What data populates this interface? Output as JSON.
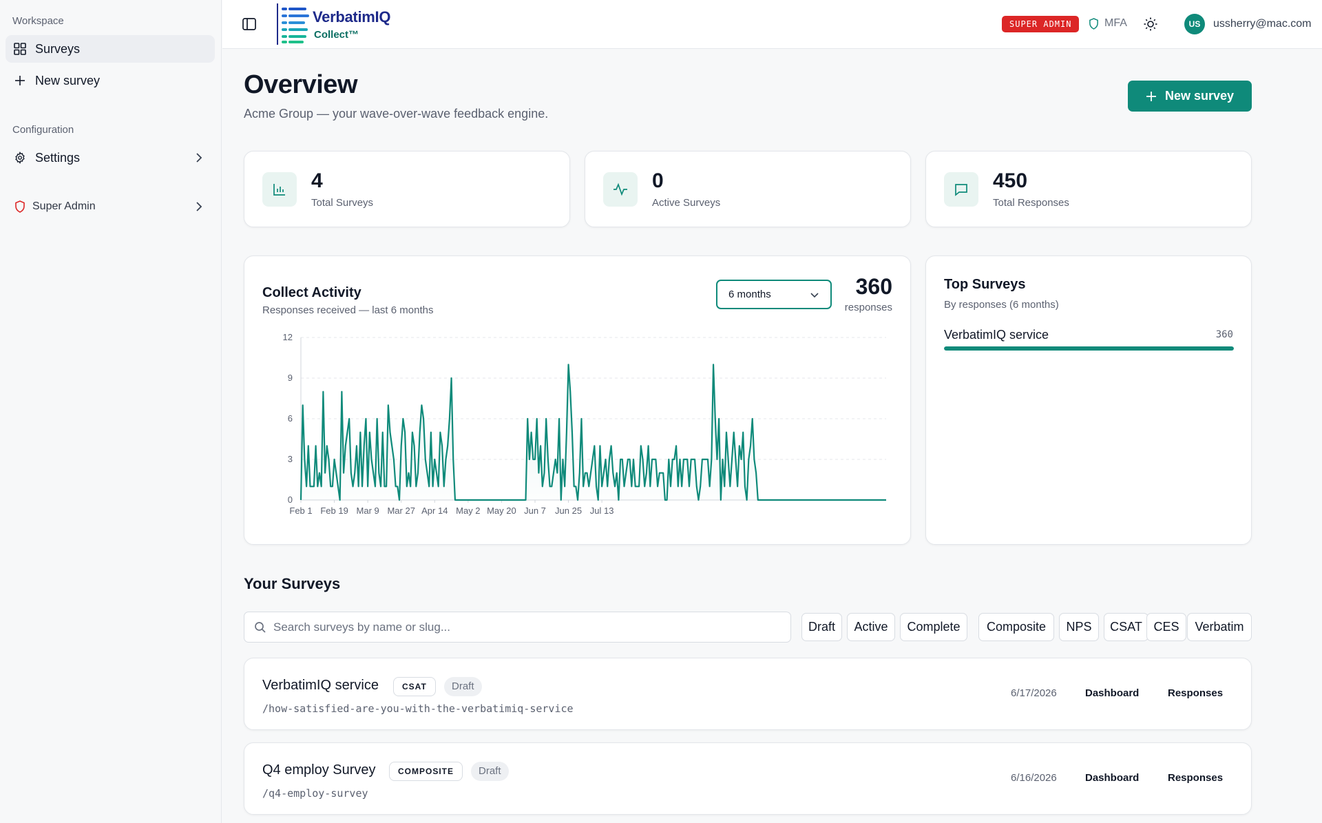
{
  "sidebar": {
    "workspace_label": "Workspace",
    "surveys_label": "Surveys",
    "new_survey_label": "New survey",
    "configuration_label": "Configuration",
    "settings_label": "Settings",
    "super_admin_label": "Super Admin"
  },
  "header": {
    "logo_name": "VerbatimIQ",
    "logo_sub": "Collect™",
    "super_admin_badge": "SUPER ADMIN",
    "mfa_label": "MFA",
    "avatar_initials": "US",
    "user_email": "ussherry@mac.com"
  },
  "page": {
    "title": "Overview",
    "subtitle": "Acme Group — your wave-over-wave feedback engine.",
    "new_survey_button": "New survey"
  },
  "stats": [
    {
      "value": "4",
      "label": "Total Surveys",
      "icon": "bar-chart-icon"
    },
    {
      "value": "0",
      "label": "Active Surveys",
      "icon": "activity-icon"
    },
    {
      "value": "450",
      "label": "Total Responses",
      "icon": "message-icon"
    }
  ],
  "activity": {
    "title": "Collect Activity",
    "subtitle": "Responses received — last 6 months",
    "range_selected": "6 months",
    "total": "360",
    "total_label": "responses"
  },
  "chart_data": {
    "type": "area",
    "title": "Collect Activity",
    "subtitle": "Responses received — last 6 months",
    "xlabel": "",
    "ylabel": "",
    "ylim": [
      0,
      12
    ],
    "yticks": [
      0,
      3,
      6,
      9,
      12
    ],
    "xtick_labels": [
      "Feb 1",
      "Feb 19",
      "Mar 9",
      "Mar 27",
      "Apr 14",
      "May 2",
      "May 20",
      "Jun 7",
      "Jun 25",
      "Jul 13"
    ],
    "grid": true,
    "legend": "none",
    "series_color": "#0f8a7a",
    "start_label": "Feb 1",
    "values": [
      0,
      7,
      3,
      1,
      4,
      1,
      1,
      1,
      4,
      1,
      2,
      1,
      8,
      2,
      4,
      3,
      1,
      1,
      3,
      2,
      1,
      0,
      8,
      2,
      4,
      5,
      6,
      2,
      1,
      2,
      4,
      1,
      5,
      1,
      4,
      6,
      1,
      5,
      3,
      2,
      1,
      6,
      2,
      1,
      5,
      1,
      1,
      7,
      5,
      4,
      3,
      1,
      1,
      0,
      4,
      6,
      5,
      1,
      2,
      1,
      5,
      4,
      1,
      2,
      5,
      7,
      6,
      3,
      2,
      1,
      5,
      1,
      3,
      2,
      1,
      5,
      4,
      1,
      3,
      4,
      6,
      9,
      3,
      0,
      0,
      0,
      0,
      0,
      0,
      0,
      0,
      0,
      0,
      0,
      0,
      0,
      0,
      0,
      0,
      0,
      0,
      0,
      0,
      0,
      0,
      0,
      0,
      0,
      0,
      0,
      0,
      0,
      0,
      0,
      0,
      0,
      0,
      0,
      0,
      0,
      0,
      0,
      6,
      3,
      5,
      3,
      3,
      6,
      2,
      4,
      1,
      2,
      6,
      3,
      1,
      1,
      2,
      3,
      2,
      6,
      0,
      3,
      1,
      5,
      10,
      8,
      5,
      1,
      1,
      0,
      2,
      6,
      1,
      2,
      2,
      1,
      2,
      3,
      4,
      1,
      0,
      4,
      1,
      2,
      3,
      1,
      3,
      4,
      2,
      1,
      2,
      0,
      3,
      3,
      1,
      2,
      3,
      3,
      1,
      3,
      1,
      1,
      1,
      4,
      3,
      1,
      2,
      4,
      1,
      3,
      3,
      3,
      1,
      2,
      2,
      2,
      0,
      0,
      3,
      1,
      3,
      3,
      4,
      1,
      3,
      1,
      3,
      3,
      3,
      1,
      3,
      3,
      3,
      1,
      0,
      1,
      3,
      3,
      3,
      3,
      1,
      3,
      10,
      6,
      3,
      6,
      0,
      3,
      1,
      5,
      3,
      1,
      3,
      5,
      3,
      1,
      4,
      3,
      5,
      1,
      0,
      3,
      4,
      6,
      3,
      2,
      0,
      0,
      0,
      0,
      0,
      0,
      0,
      0,
      0,
      0,
      0,
      0,
      0,
      0,
      0,
      0,
      0,
      0,
      0,
      0,
      0,
      0,
      0,
      0,
      0,
      0,
      0,
      0,
      0,
      0,
      0,
      0,
      0,
      0,
      0,
      0,
      0,
      0,
      0,
      0,
      0,
      0,
      0,
      0,
      0,
      0,
      0,
      0,
      0,
      0,
      0,
      0,
      0,
      0,
      0,
      0,
      0,
      0,
      0,
      0,
      0,
      0,
      0,
      0,
      0,
      0,
      0,
      0,
      0,
      0
    ]
  },
  "top_surveys": {
    "title": "Top Surveys",
    "subtitle": "By responses (6 months)",
    "items": [
      {
        "name": "VerbatimIQ service",
        "value": "360",
        "share": 1.0
      }
    ]
  },
  "your_surveys": {
    "title": "Your Surveys",
    "search_placeholder": "Search surveys by name or slug...",
    "status_filters": [
      "Draft",
      "Active",
      "Complete"
    ],
    "type_filters": [
      "Composite",
      "NPS",
      "CSAT",
      "CES",
      "Verbatim"
    ],
    "rows": [
      {
        "name": "VerbatimIQ service",
        "type": "CSAT",
        "status": "Draft",
        "slug": "/how-satisfied-are-you-with-the-verbatimiq-service",
        "date": "6/17/2026",
        "dashboard": "Dashboard",
        "responses": "Responses"
      },
      {
        "name": "Q4 employ Survey",
        "type": "COMPOSITE",
        "status": "Draft",
        "slug": "/q4-employ-survey",
        "date": "6/16/2026",
        "dashboard": "Dashboard",
        "responses": "Responses"
      }
    ]
  }
}
